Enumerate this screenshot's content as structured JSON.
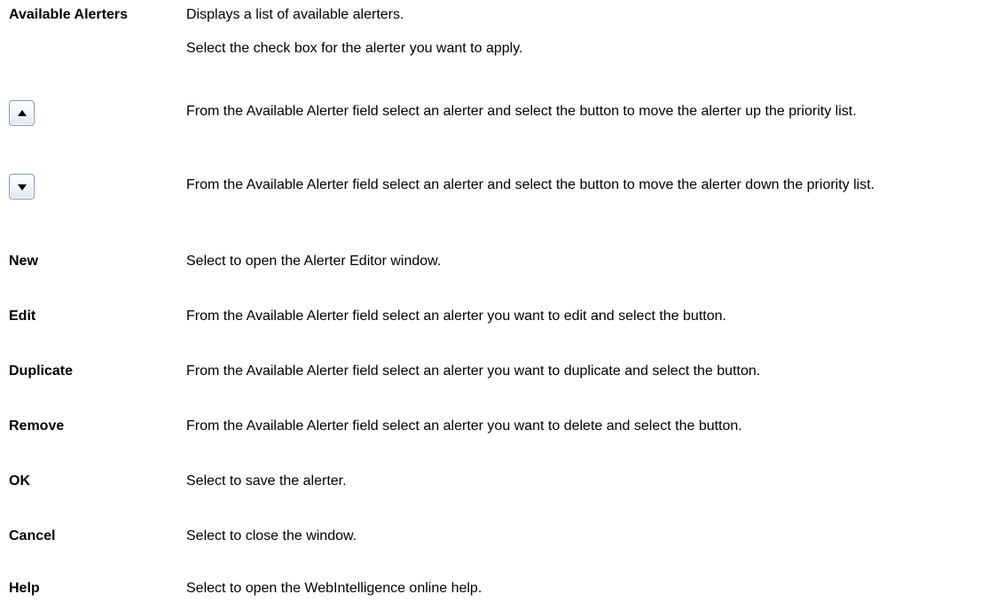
{
  "rows": {
    "available_alerters": {
      "term": "Available Alerters",
      "desc": [
        "Displays a list of available alerters.",
        "Select the check box for the alerter you want to apply."
      ]
    },
    "move_up": {
      "icon": "arrow-up-icon",
      "desc": "From the Available Alerter field select an alerter and select the button to move the alerter up the priority list."
    },
    "move_down": {
      "icon": "arrow-down-icon",
      "desc": "From the Available Alerter field select an alerter and select the button to move the alerter down the priority list."
    },
    "new": {
      "term": "New",
      "desc": "Select to open the Alerter Editor window."
    },
    "edit": {
      "term": "Edit",
      "desc": "From the Available Alerter field select an alerter you want to edit and select the button."
    },
    "duplicate": {
      "term": "Duplicate",
      "desc": "From the Available Alerter field select an alerter you want to duplicate and select the button."
    },
    "remove": {
      "term": "Remove",
      "desc": "From the Available Alerter field select an alerter you want to delete and select the button."
    },
    "ok": {
      "term": "OK",
      "desc": "Select to save the alerter."
    },
    "cancel": {
      "term": "Cancel",
      "desc": "Select to close the window."
    },
    "help": {
      "term": "Help",
      "desc": "Select to open the WebIntelligence online help."
    }
  }
}
